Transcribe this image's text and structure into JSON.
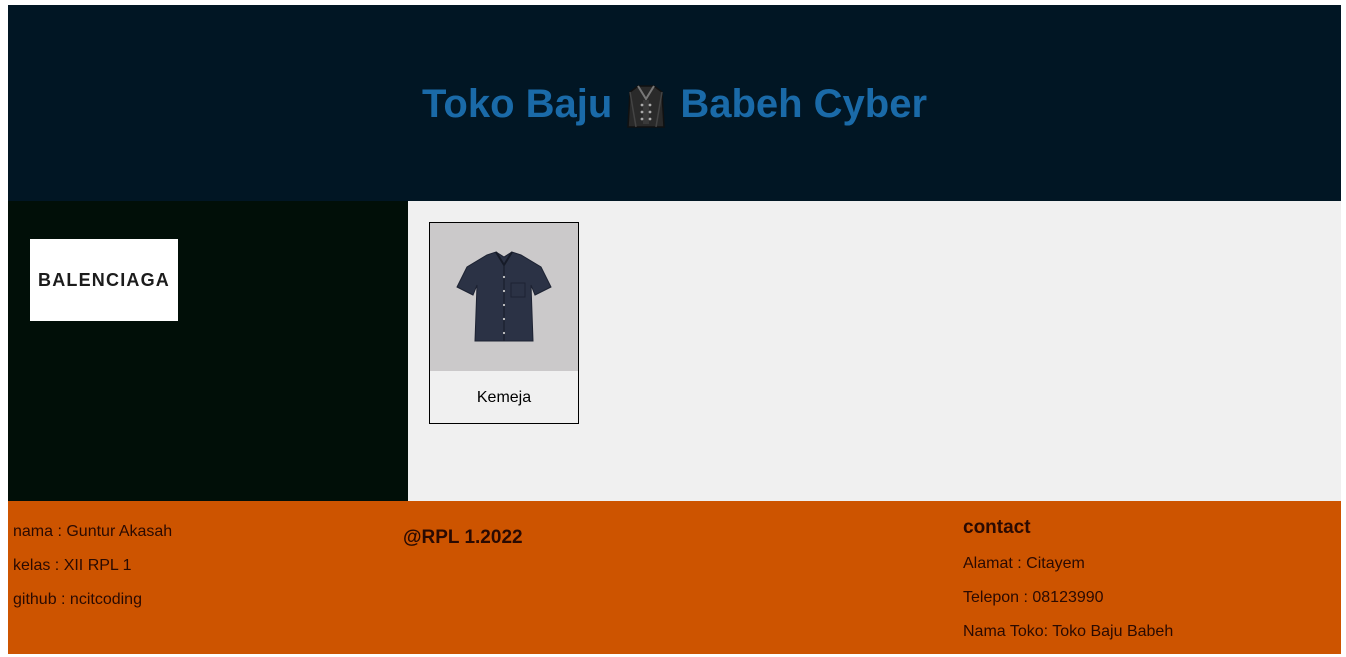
{
  "header": {
    "title_left": "Toko Baju",
    "title_icon": "coat-icon",
    "title_right": "Babeh Cyber",
    "title_color": "#1a6aa8",
    "background": "#011624"
  },
  "sidebar": {
    "logo_text": "BALENCIAGA",
    "background": "#010f08"
  },
  "products": [
    {
      "name": "Kemeja",
      "icon": "shirt-icon"
    }
  ],
  "footer": {
    "background": "#cd5400",
    "left": [
      "nama : Guntur Akasah",
      "kelas : XII RPL 1",
      "github : ncitcoding"
    ],
    "copyright": "@RPL 1.2022",
    "contact_title": "contact",
    "contact": [
      "Alamat : Citayem",
      "Telepon : 08123990",
      "Nama Toko: Toko Baju Babeh"
    ]
  }
}
